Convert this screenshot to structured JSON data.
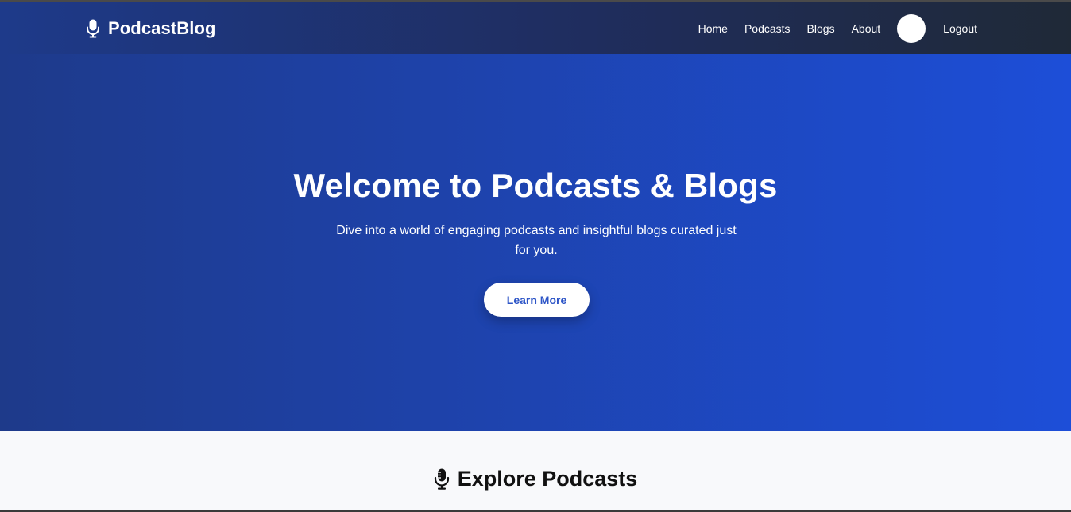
{
  "navbar": {
    "brand": {
      "name": "PodcastBlog",
      "icon": "microphone-icon"
    },
    "links": [
      "Home",
      "Podcasts",
      "Blogs",
      "About"
    ],
    "logout_label": "Logout"
  },
  "hero": {
    "title": "Welcome to Podcasts & Blogs",
    "subtitle": "Dive into a world of engaging podcasts and insightful blogs curated just for you.",
    "cta_label": "Learn More"
  },
  "explore": {
    "icon": "microphone-icon",
    "title": "Explore Podcasts"
  },
  "colors": {
    "nav_start": "#1e3a8a",
    "nav_end": "#1f2937",
    "hero_start": "#1e3a8a",
    "hero_end": "#1d4ed8",
    "cta_text": "#2d55c7",
    "section_bg": "#f8f9fb"
  }
}
